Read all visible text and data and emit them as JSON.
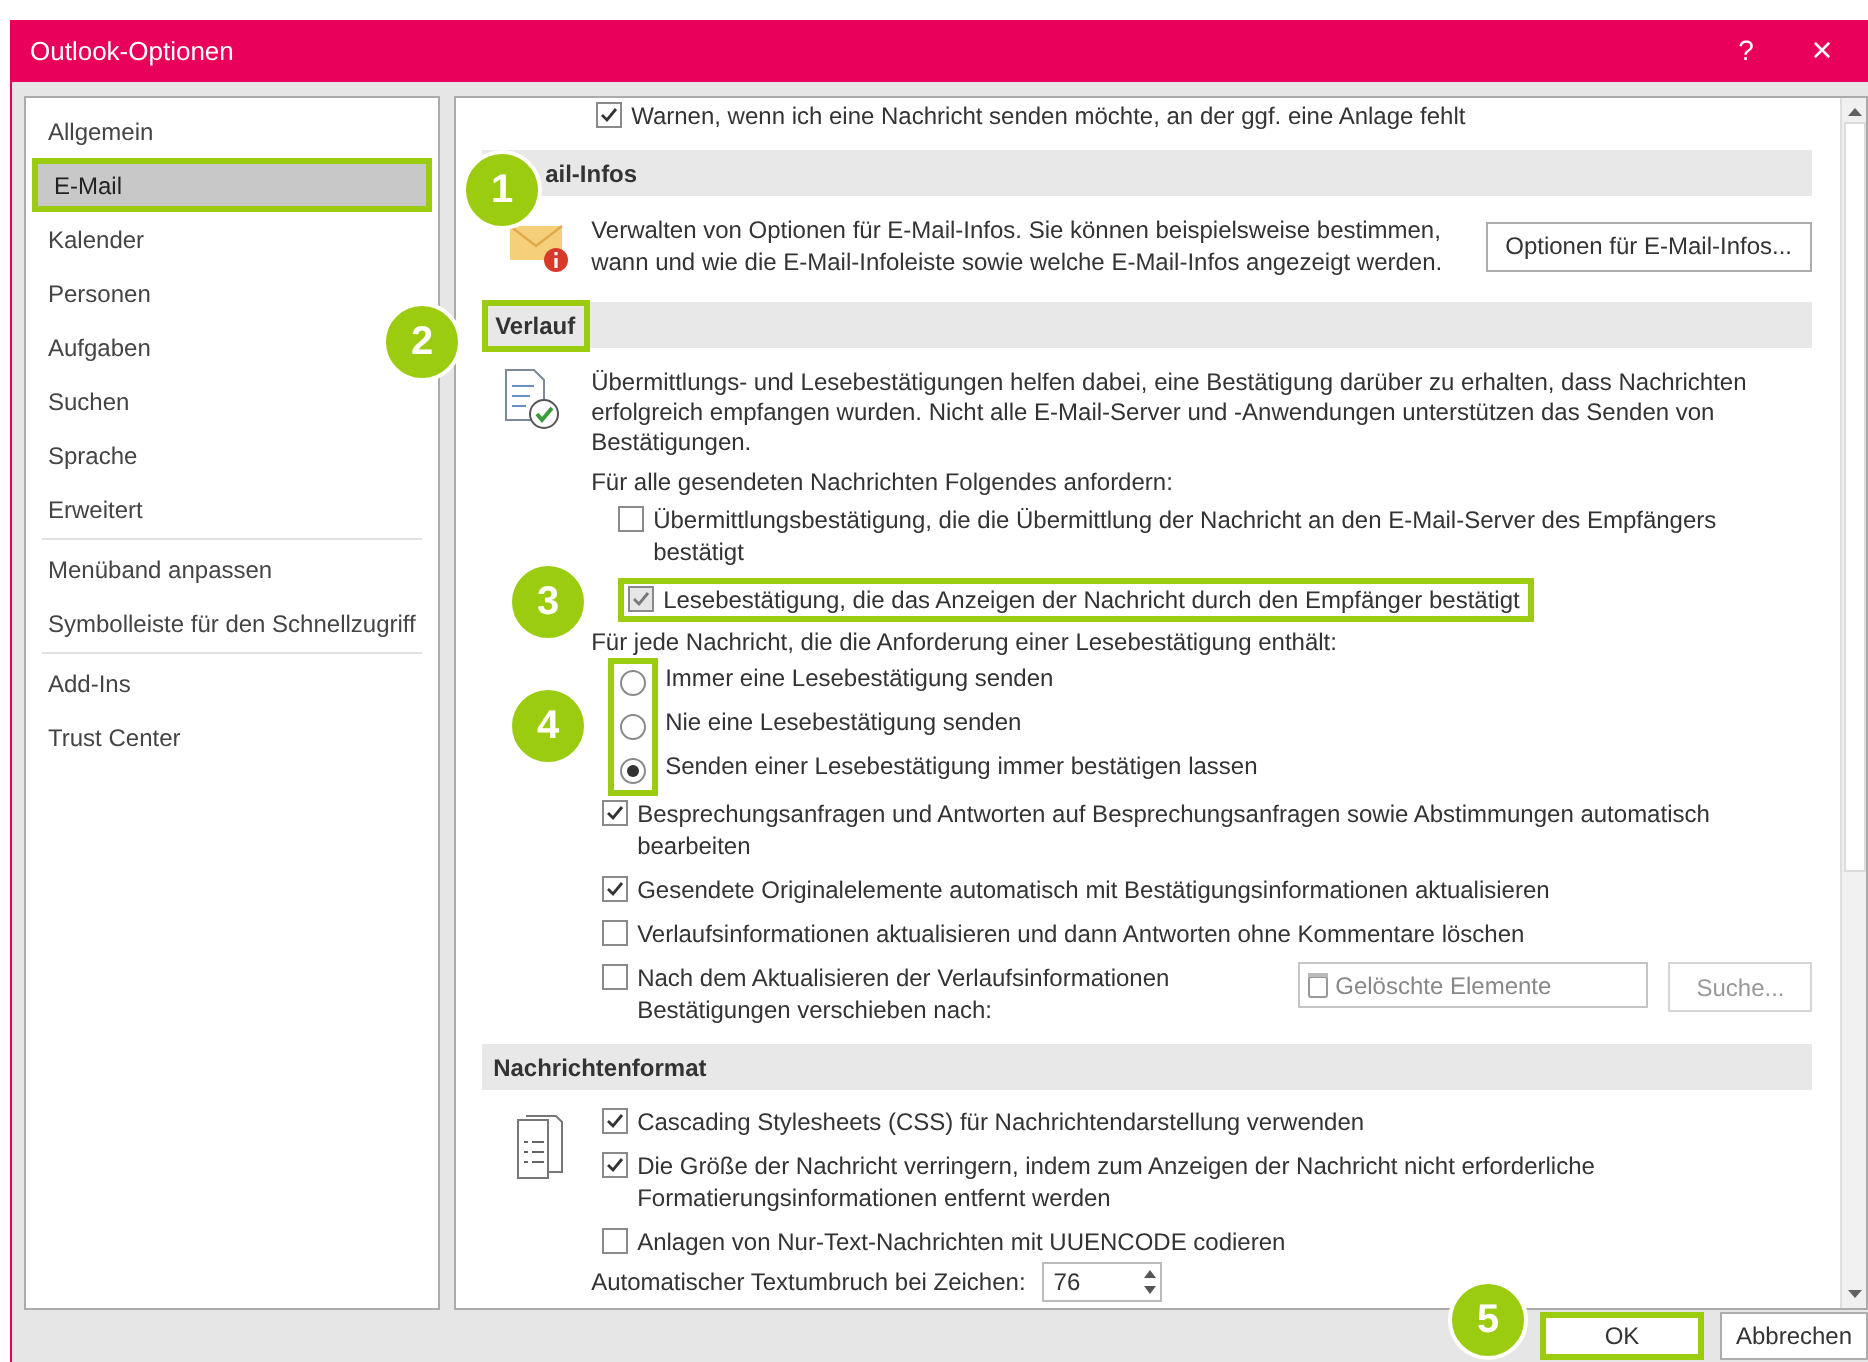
{
  "window": {
    "title": "Outlook-Optionen",
    "help": "?",
    "close": "×"
  },
  "sidebar": {
    "groups": [
      [
        {
          "label": "Allgemein",
          "selected": false,
          "highlighted": false
        },
        {
          "label": "E-Mail",
          "selected": true,
          "highlighted": true
        },
        {
          "label": "Kalender",
          "selected": false,
          "highlighted": false
        },
        {
          "label": "Personen",
          "selected": false,
          "highlighted": false
        },
        {
          "label": "Aufgaben",
          "selected": false,
          "highlighted": false
        },
        {
          "label": "Suchen",
          "selected": false,
          "highlighted": false
        },
        {
          "label": "Sprache",
          "selected": false,
          "highlighted": false
        },
        {
          "label": "Erweitert",
          "selected": false,
          "highlighted": false
        }
      ],
      [
        {
          "label": "Menüband anpassen",
          "selected": false,
          "highlighted": false
        },
        {
          "label": "Symbolleiste für den Schnellzugriff",
          "selected": false,
          "highlighted": false
        }
      ],
      [
        {
          "label": "Add-Ins",
          "selected": false,
          "highlighted": false
        },
        {
          "label": "Trust Center",
          "selected": false,
          "highlighted": false
        }
      ]
    ]
  },
  "content": {
    "warn_attachment": {
      "label": "Warnen, wenn ich eine Nachricht senden möchte, an der ggf. eine Anlage fehlt",
      "checked": true
    },
    "mailtips": {
      "heading": "ail-Infos",
      "description": "Verwalten von Optionen für E-Mail-Infos. Sie können beispielsweise bestimmen, wann und wie die E-Mail-Infoleiste sowie welche E-Mail-Infos angezeigt werden.",
      "button": "Optionen für E-Mail-Infos..."
    },
    "tracking": {
      "heading": "Verlauf",
      "highlighted": true,
      "description": "Übermittlungs- und Lesebestätigungen helfen dabei, eine Bestätigung darüber zu erhalten, dass Nachrichten erfolgreich empfangen wurden. Nicht alle E-Mail-Server und -Anwendungen unterstützen das Senden von Bestätigungen.",
      "request_label": "Für alle gesendeten Nachrichten Folgendes anfordern:",
      "requests": [
        {
          "label": "Übermittlungsbestätigung, die die Übermittlung der Nachricht an den E-Mail-Server des Empfängers bestätigt",
          "checked": false,
          "highlighted": false
        },
        {
          "label": "Lesebestätigung, die das Anzeigen der Nachricht durch den Empfänger bestätigt",
          "checked": true,
          "highlighted": true
        }
      ],
      "response_label": "Für jede Nachricht, die die Anforderung einer Lesebestätigung enthält:",
      "responses_highlighted": true,
      "responses": [
        {
          "label": "Immer eine Lesebestätigung senden",
          "selected": false
        },
        {
          "label": "Nie eine Lesebestätigung senden",
          "selected": false
        },
        {
          "label": "Senden einer Lesebestätigung immer bestätigen lassen",
          "selected": true
        }
      ],
      "options": [
        {
          "label": "Besprechungsanfragen und Antworten auf Besprechungsanfragen sowie Abstimmungen automatisch bearbeiten",
          "checked": true
        },
        {
          "label": "Gesendete Originalelemente automatisch mit Bestätigungsinformationen aktualisieren",
          "checked": true
        },
        {
          "label": "Verlaufsinformationen aktualisieren und dann Antworten ohne Kommentare löschen",
          "checked": false
        }
      ],
      "move_option": {
        "label": "Nach dem Aktualisieren der Verlaufsinformationen Bestätigungen verschieben nach:",
        "checked": false,
        "folder": "Gelöschte Elemente",
        "browse": "Suche..."
      }
    },
    "format": {
      "heading": "Nachrichtenformat",
      "options": [
        {
          "label": "Cascading Stylesheets (CSS) für Nachrichtendarstellung verwenden",
          "checked": true
        },
        {
          "label": "Die Größe der Nachricht verringern, indem zum Anzeigen der Nachricht nicht erforderliche Formatierungsinformationen entfernt werden",
          "checked": true
        },
        {
          "label": "Anlagen von Nur-Text-Nachrichten mit UUENCODE codieren",
          "checked": false
        }
      ],
      "wrap_label": "Automatischer Textumbruch bei Zeichen:",
      "wrap_value": "76"
    }
  },
  "buttons": [
    {
      "label": "OK",
      "highlighted": true
    },
    {
      "label": "Abbrechen",
      "highlighted": false
    }
  ],
  "badges": [
    "1",
    "2",
    "3",
    "4",
    "5"
  ]
}
